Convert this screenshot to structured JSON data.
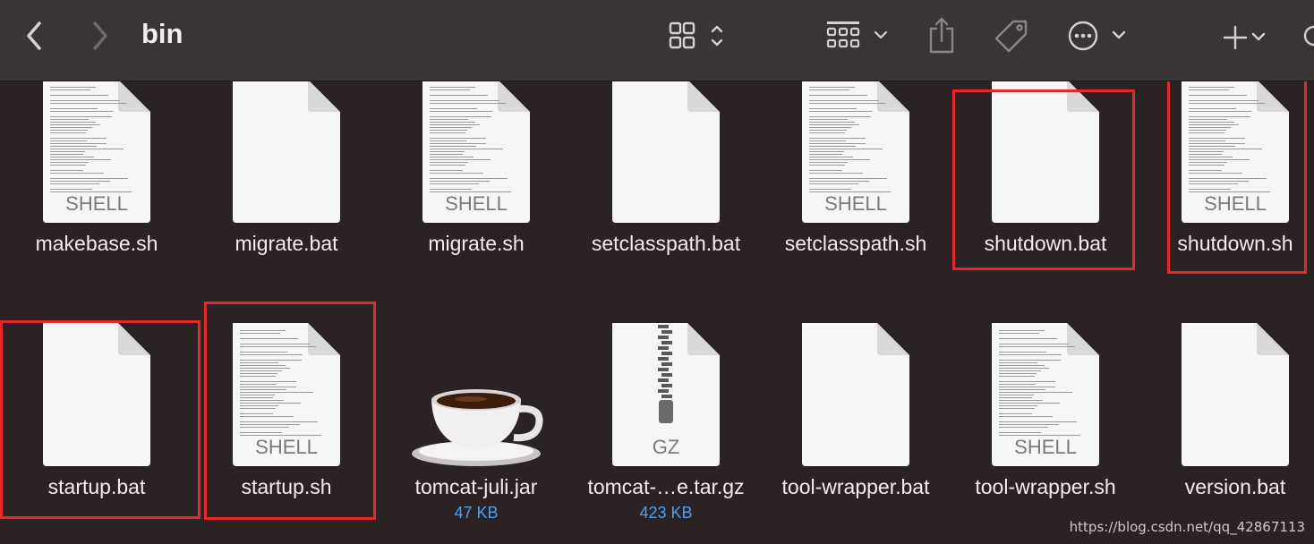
{
  "window": {
    "title": "bin"
  },
  "toolbar": {
    "back": "chevron-left-icon",
    "forward": "chevron-right-icon",
    "view": "grid-view-icon",
    "group": "group-by-icon",
    "share": "share-icon",
    "tag": "tag-icon",
    "action": "more-icon",
    "new": "plus-icon"
  },
  "files": [
    {
      "name": "makebase.sh",
      "kind": "shell",
      "badge": "SHELL"
    },
    {
      "name": "migrate.bat",
      "kind": "blank",
      "badge": ""
    },
    {
      "name": "migrate.sh",
      "kind": "shell",
      "badge": "SHELL"
    },
    {
      "name": "setclasspath.bat",
      "kind": "blank",
      "badge": ""
    },
    {
      "name": "setclasspath.sh",
      "kind": "shell",
      "badge": "SHELL"
    },
    {
      "name": "shutdown.bat",
      "kind": "blank",
      "badge": ""
    },
    {
      "name": "shutdown.sh",
      "kind": "shell",
      "badge": "SHELL"
    },
    {
      "name": "startup.bat",
      "kind": "blank",
      "badge": ""
    },
    {
      "name": "startup.sh",
      "kind": "shell",
      "badge": "SHELL"
    },
    {
      "name": "tomcat-juli.jar",
      "kind": "jar",
      "badge": "",
      "size": "47 KB"
    },
    {
      "name": "tomcat-…e.tar.gz",
      "kind": "gz",
      "badge": "GZ",
      "size": "423 KB"
    },
    {
      "name": "tool-wrapper.bat",
      "kind": "blank",
      "badge": ""
    },
    {
      "name": "tool-wrapper.sh",
      "kind": "shell",
      "badge": "SHELL"
    },
    {
      "name": "version.bat",
      "kind": "blank",
      "badge": ""
    }
  ],
  "highlighted": [
    "shutdown.bat",
    "shutdown.sh",
    "startup.bat",
    "startup.sh"
  ],
  "colors": {
    "highlight": "#e5272a",
    "size": "#4d9ff2",
    "background": "#2b2224"
  },
  "watermark": "https://blog.csdn.net/qq_42867113"
}
